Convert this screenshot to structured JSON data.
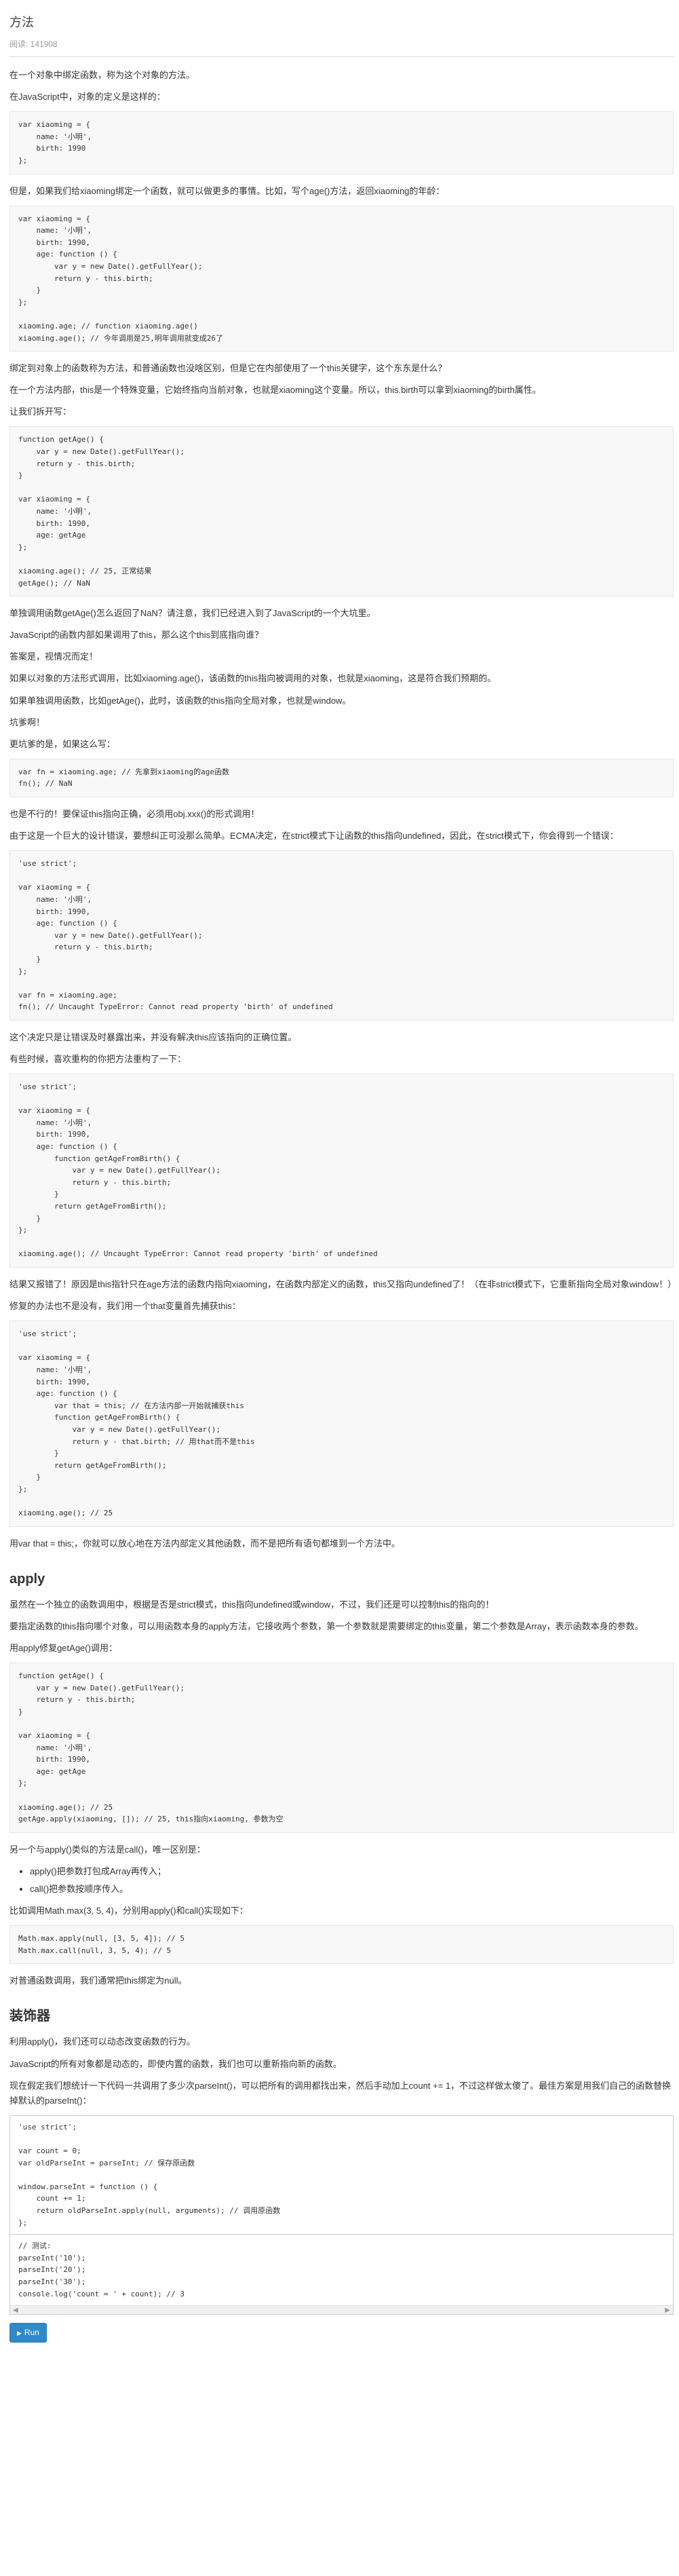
{
  "header": {
    "title": "方法",
    "views": "阅读: 141908"
  },
  "p1": "在一个对象中绑定函数，称为这个对象的方法。",
  "p2": "在JavaScript中，对象的定义是这样的：",
  "code1": "var xiaoming = {\n    name: '小明',\n    birth: 1990\n};",
  "p3": "但是，如果我们给xiaoming绑定一个函数，就可以做更多的事情。比如，写个age()方法，返回xiaoming的年龄：",
  "code2": "var xiaoming = {\n    name: '小明',\n    birth: 1990,\n    age: function () {\n        var y = new Date().getFullYear();\n        return y - this.birth;\n    }\n};\n\nxiaoming.age; // function xiaoming.age()\nxiaoming.age(); // 今年调用是25,明年调用就变成26了",
  "p4": "绑定到对象上的函数称为方法，和普通函数也没啥区别，但是它在内部使用了一个this关键字，这个东东是什么？",
  "p5": "在一个方法内部，this是一个特殊变量，它始终指向当前对象，也就是xiaoming这个变量。所以，this.birth可以拿到xiaoming的birth属性。",
  "p6": "让我们拆开写：",
  "code3": "function getAge() {\n    var y = new Date().getFullYear();\n    return y - this.birth;\n}\n\nvar xiaoming = {\n    name: '小明',\n    birth: 1990,\n    age: getAge\n};\n\nxiaoming.age(); // 25, 正常结果\ngetAge(); // NaN",
  "p7": "单独调用函数getAge()怎么返回了NaN？请注意，我们已经进入到了JavaScript的一个大坑里。",
  "p8": "JavaScript的函数内部如果调用了this，那么这个this到底指向谁？",
  "p9": "答案是，视情况而定！",
  "p10": "如果以对象的方法形式调用，比如xiaoming.age()，该函数的this指向被调用的对象，也就是xiaoming，这是符合我们预期的。",
  "p11": "如果单独调用函数，比如getAge()，此时，该函数的this指向全局对象，也就是window。",
  "p12": "坑爹啊！",
  "p13": "更坑爹的是，如果这么写：",
  "code4": "var fn = xiaoming.age; // 先拿到xiaoming的age函数\nfn(); // NaN",
  "p14": "也是不行的！要保证this指向正确，必须用obj.xxx()的形式调用！",
  "p15": "由于这是一个巨大的设计错误，要想纠正可没那么简单。ECMA决定，在strict模式下让函数的this指向undefined，因此，在strict模式下，你会得到一个错误：",
  "code5": "'use strict';\n\nvar xiaoming = {\n    name: '小明',\n    birth: 1990,\n    age: function () {\n        var y = new Date().getFullYear();\n        return y - this.birth;\n    }\n};\n\nvar fn = xiaoming.age;\nfn(); // Uncaught TypeError: Cannot read property 'birth' of undefined",
  "p16": "这个决定只是让错误及时暴露出来，并没有解决this应该指向的正确位置。",
  "p17": "有些时候，喜欢重构的你把方法重构了一下：",
  "code6": "'use strict';\n\nvar xiaoming = {\n    name: '小明',\n    birth: 1990,\n    age: function () {\n        function getAgeFromBirth() {\n            var y = new Date().getFullYear();\n            return y - this.birth;\n        }\n        return getAgeFromBirth();\n    }\n};\n\nxiaoming.age(); // Uncaught TypeError: Cannot read property 'birth' of undefined",
  "p18": "结果又报错了！原因是this指针只在age方法的函数内指向xiaoming，在函数内部定义的函数，this又指向undefined了！（在非strict模式下，它重新指向全局对象window！）",
  "p19": "修复的办法也不是没有，我们用一个that变量首先捕获this：",
  "code7": "'use strict';\n\nvar xiaoming = {\n    name: '小明',\n    birth: 1990,\n    age: function () {\n        var that = this; // 在方法内部一开始就捕获this\n        function getAgeFromBirth() {\n            var y = new Date().getFullYear();\n            return y - that.birth; // 用that而不是this\n        }\n        return getAgeFromBirth();\n    }\n};\n\nxiaoming.age(); // 25",
  "p20": "用var that = this;，你就可以放心地在方法内部定义其他函数，而不是把所有语句都堆到一个方法中。",
  "h_apply": "apply",
  "p21": "虽然在一个独立的函数调用中，根据是否是strict模式，this指向undefined或window，不过，我们还是可以控制this的指向的！",
  "p22": "要指定函数的this指向哪个对象，可以用函数本身的apply方法，它接收两个参数，第一个参数就是需要绑定的this变量，第二个参数是Array，表示函数本身的参数。",
  "p23": "用apply修复getAge()调用：",
  "code8": "function getAge() {\n    var y = new Date().getFullYear();\n    return y - this.birth;\n}\n\nvar xiaoming = {\n    name: '小明',\n    birth: 1990,\n    age: getAge\n};\n\nxiaoming.age(); // 25\ngetAge.apply(xiaoming, []); // 25, this指向xiaoming, 参数为空",
  "p24": "另一个与apply()类似的方法是call()，唯一区别是：",
  "li1": "apply()把参数打包成Array再传入；",
  "li2": "call()把参数按顺序传入。",
  "p25": "比如调用Math.max(3, 5, 4)，分别用apply()和call()实现如下：",
  "code9": "Math.max.apply(null, [3, 5, 4]); // 5\nMath.max.call(null, 3, 5, 4); // 5",
  "p26": "对普通函数调用，我们通常把this绑定为null。",
  "h_decorator": "装饰器",
  "p27": "利用apply()，我们还可以动态改变函数的行为。",
  "p28": "JavaScript的所有对象都是动态的，即使内置的函数，我们也可以重新指向新的函数。",
  "p29": "现在假定我们想统计一下代码一共调用了多少次parseInt()，可以把所有的调用都找出来，然后手动加上count += 1，不过这样做太傻了。最佳方案是用我们自己的函数替换掉默认的parseInt()：",
  "editor_code": "'use strict';\n\nvar count = 0;\nvar oldParseInt = parseInt; // 保存原函数\n\nwindow.parseInt = function () {\n    count += 1;\n    return oldParseInt.apply(null, arguments); // 调用原函数\n};",
  "editor_test": "// 测试:\nparseInt('10');\nparseInt('20');\nparseInt('30');\nconsole.log('count = ' + count); // 3",
  "run_label": "Run"
}
